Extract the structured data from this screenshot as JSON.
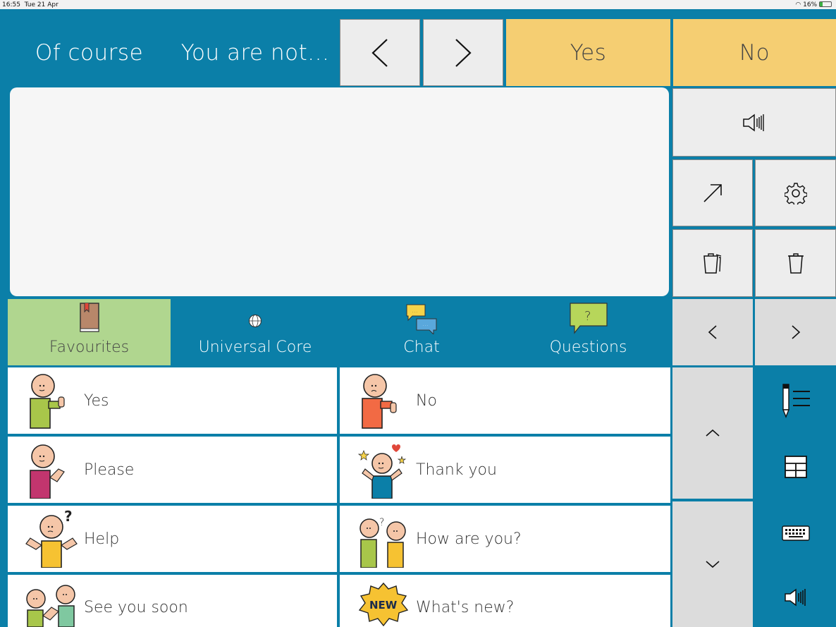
{
  "status": {
    "time": "16:55",
    "date": "Tue 21 Apr",
    "battery": "16%"
  },
  "top_row": {
    "of_course": "Of course",
    "you_are_not": "You are not...",
    "prev": "<",
    "next": ">",
    "yes": "Yes",
    "no": "No"
  },
  "message_box": {
    "text": ""
  },
  "side_controls": {
    "speak_icon": "speaker-icon",
    "share_icon": "arrow-up-right-icon",
    "settings_icon": "gear-icon",
    "clear_all_icon": "trash-all-icon",
    "delete_icon": "trash-icon",
    "page_prev": "<",
    "page_next": ">"
  },
  "categories": [
    {
      "label": "Favourites",
      "icon": "book-icon",
      "bg": "#b0d68f"
    },
    {
      "label": "Universal Core",
      "icon": "globe-icon",
      "bg": "#0b7fa8"
    },
    {
      "label": "Chat",
      "icon": "chat-bubbles-icon",
      "bg": "#0b7fa8"
    },
    {
      "label": "Questions",
      "icon": "question-bubble-icon",
      "bg": "#0b7fa8"
    }
  ],
  "phrases": [
    {
      "left": "Yes",
      "right": "No"
    },
    {
      "left": "Please",
      "right": "Thank you"
    },
    {
      "left": "Help",
      "right": "How are you?"
    },
    {
      "left": "See you soon",
      "right": "What's new?"
    }
  ],
  "scroll": {
    "up": "^",
    "down": "v"
  },
  "tools": [
    "edit-list-icon",
    "grid-icon",
    "keyboard-icon",
    "speaker-icon"
  ],
  "colors": {
    "brand_blue": "#0b7fa8",
    "yellow": "#f5ce72",
    "green": "#b0d68f"
  }
}
